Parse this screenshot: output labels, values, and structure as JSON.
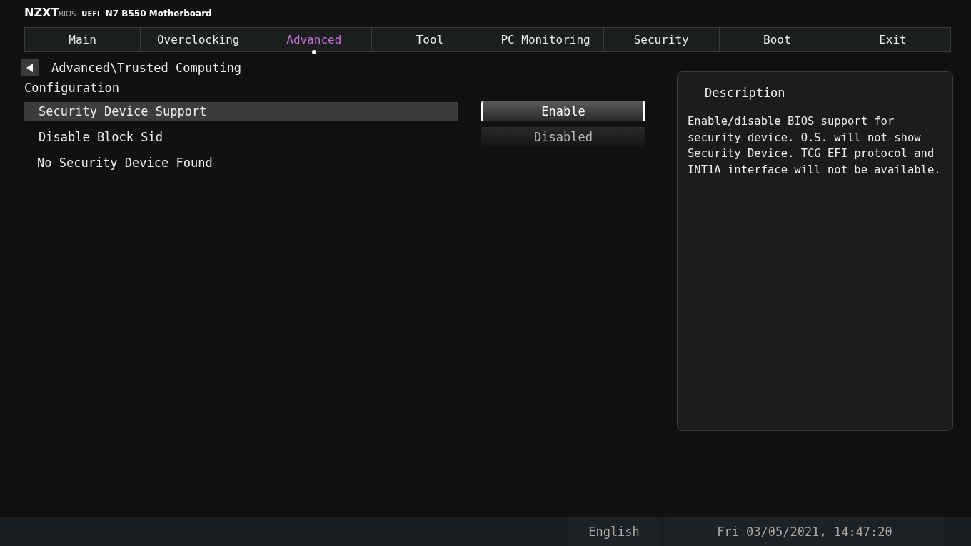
{
  "header": {
    "brand": "NZXT",
    "bios": "BIOS",
    "uefi": "UEFI",
    "model": "N7 B550 Motherboard"
  },
  "tabs": [
    {
      "label": "Main",
      "selected": false
    },
    {
      "label": "Overclocking",
      "selected": false
    },
    {
      "label": "Advanced",
      "selected": true
    },
    {
      "label": "Tool",
      "selected": false
    },
    {
      "label": "PC Monitoring",
      "selected": false
    },
    {
      "label": "Security",
      "selected": false
    },
    {
      "label": "Boot",
      "selected": false
    },
    {
      "label": "Exit",
      "selected": false
    }
  ],
  "breadcrumb": "Advanced\\Trusted Computing",
  "section": "Configuration",
  "items": [
    {
      "kind": "setting",
      "label": "Security Device Support",
      "value": "Enable",
      "selected": true
    },
    {
      "kind": "setting",
      "label": "Disable Block Sid",
      "value": "Disabled",
      "selected": false
    },
    {
      "kind": "text",
      "label": "No Security Device Found"
    }
  ],
  "description": {
    "title": "Description",
    "text": "Enable/disable BIOS support for security device. O.S. will not show Security Device. TCG EFI protocol and INT1A interface will not be available."
  },
  "status_bar": {
    "language": "English",
    "datetime": "Fri 03/05/2021, 14:47:20"
  }
}
